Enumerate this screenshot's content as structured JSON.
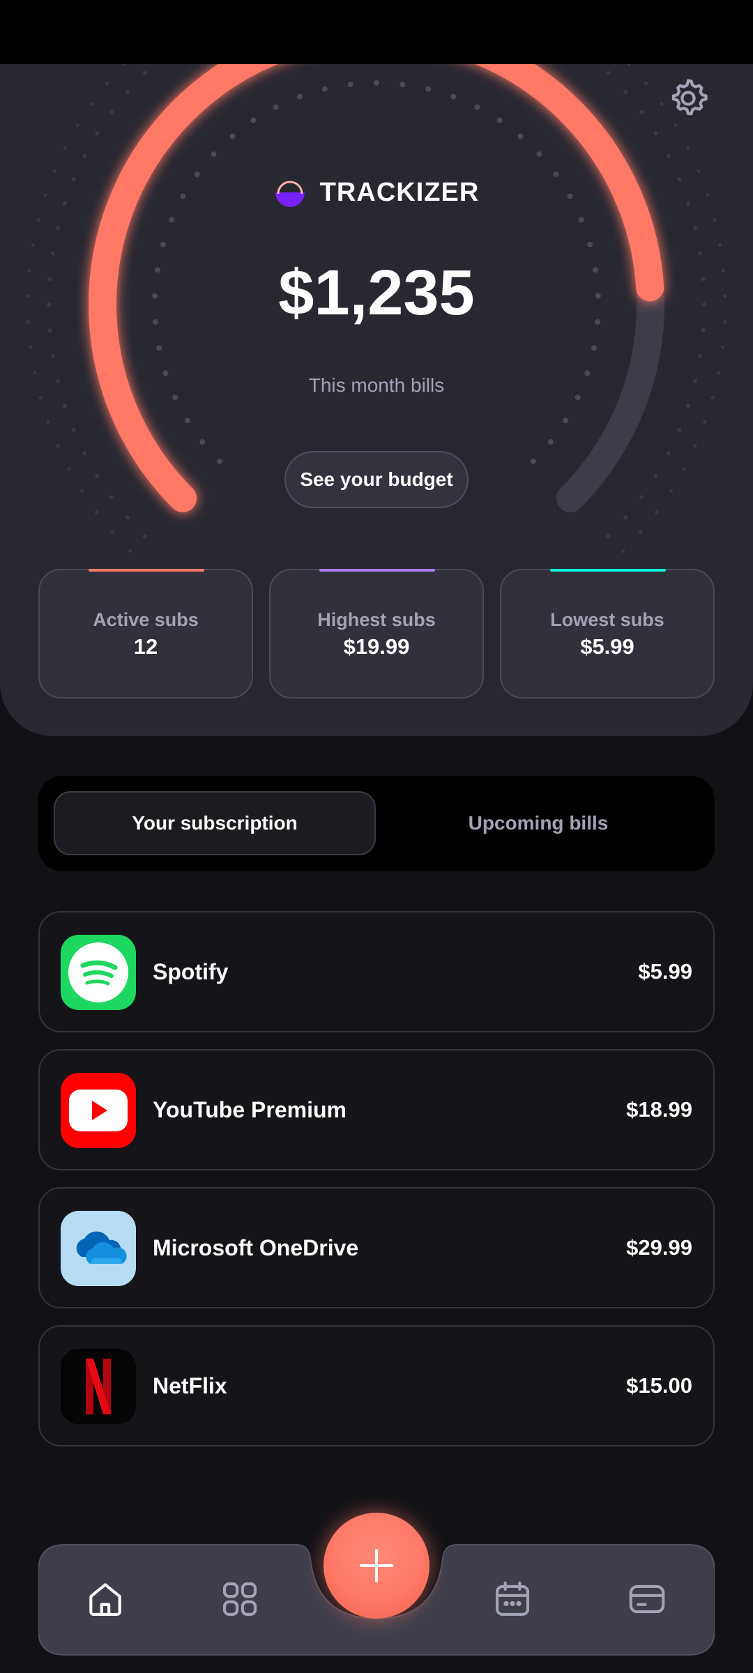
{
  "brand": {
    "name": "TRACKIZER"
  },
  "summary": {
    "total": "$1,235",
    "subtitle": "This month bills",
    "budget_button": "See your budget",
    "gauge_fraction": 0.82
  },
  "stats": [
    {
      "label": "Active subs",
      "value": "12",
      "accent": "#ff7966"
    },
    {
      "label": "Highest subs",
      "value": "$19.99",
      "accent": "#ad7bff"
    },
    {
      "label": "Lowest subs",
      "value": "$5.99",
      "accent": "#00fad9"
    }
  ],
  "tabs": [
    {
      "label": "Your subscription",
      "active": true
    },
    {
      "label": "Upcoming bills",
      "active": false
    }
  ],
  "subscriptions": [
    {
      "name": "Spotify",
      "price": "$5.99",
      "icon": "spotify-icon"
    },
    {
      "name": "YouTube Premium",
      "price": "$18.99",
      "icon": "youtube-icon"
    },
    {
      "name": "Microsoft OneDrive",
      "price": "$29.99",
      "icon": "onedrive-icon"
    },
    {
      "name": "NetFlix",
      "price": "$15.00",
      "icon": "netflix-icon"
    }
  ],
  "nav": {
    "items": [
      "home-icon",
      "grid-icon",
      "calendar-icon",
      "card-icon"
    ],
    "add": "add-icon"
  },
  "colors": {
    "accent": "#ff7966",
    "background": "#121216",
    "panel": "#282831"
  }
}
